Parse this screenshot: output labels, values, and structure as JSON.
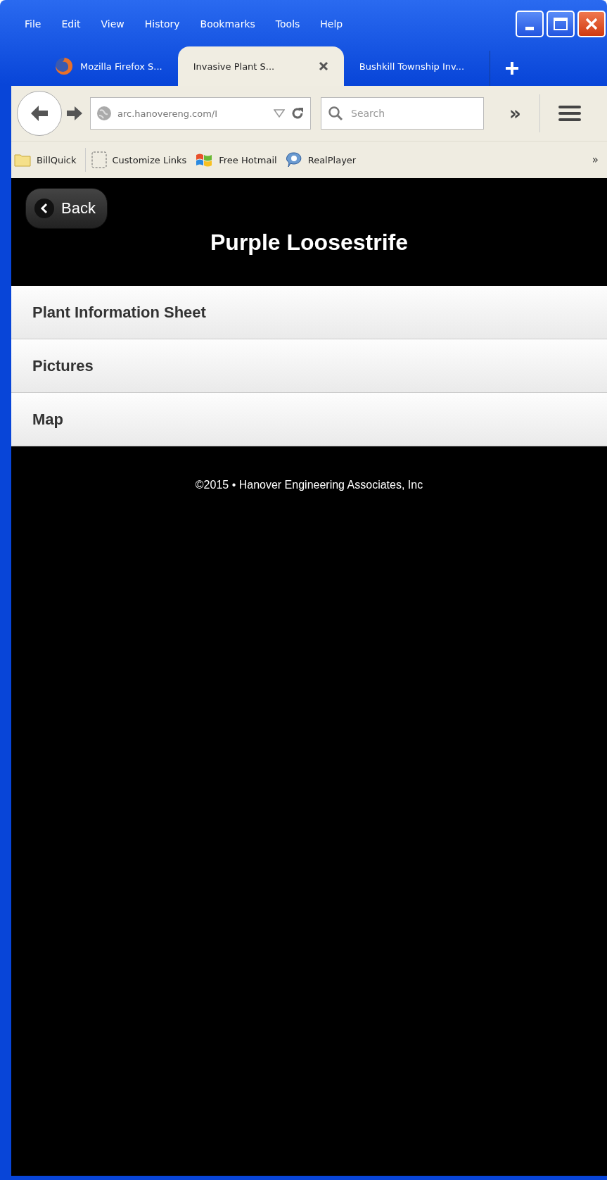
{
  "menu": [
    "File",
    "Edit",
    "View",
    "History",
    "Bookmarks",
    "Tools",
    "Help"
  ],
  "tabs": [
    {
      "label": "Mozilla Firefox S...",
      "selected": false,
      "kind": "firefox"
    },
    {
      "label": "Invasive Plant S...",
      "selected": true,
      "kind": "plain"
    },
    {
      "label": "Bushkill Township Inv...",
      "selected": false,
      "kind": "plain"
    }
  ],
  "url": "arc.hanovereng.com/I",
  "search": {
    "placeholder": "Search"
  },
  "overflow": "»",
  "bookmarks": [
    {
      "label": "BillQuick",
      "kind": "folder"
    },
    {
      "label": "Customize Links",
      "kind": "dashed"
    },
    {
      "label": "Free Hotmail",
      "kind": "windows"
    },
    {
      "label": "RealPlayer",
      "kind": "real"
    }
  ],
  "bookmarks_overflow": "»",
  "page": {
    "back": "Back",
    "title": "Purple Loosestrife",
    "items": [
      "Plant Information Sheet",
      "Pictures",
      "Map"
    ],
    "footer": "©2015 • Hanover Engineering Associates, Inc"
  }
}
